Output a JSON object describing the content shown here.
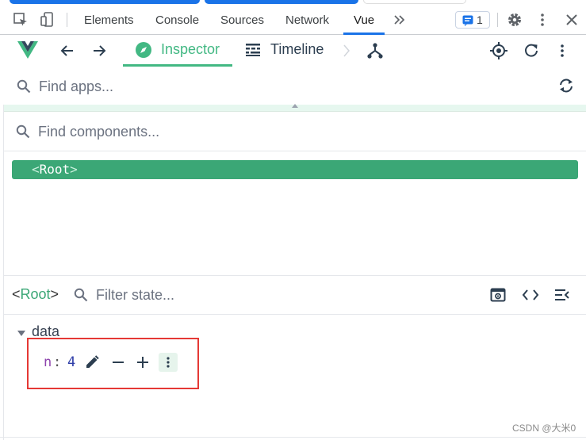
{
  "devtools": {
    "tabs": [
      "Elements",
      "Console",
      "Sources",
      "Network",
      "Vue"
    ],
    "active_tab": "Vue",
    "issues_count": "1",
    "accent": "#1a73e8"
  },
  "vue_toolbar": {
    "tabs": [
      {
        "label": "Inspector",
        "icon": "compass-icon"
      },
      {
        "label": "Timeline",
        "icon": "timeline-icon"
      }
    ],
    "active": "Inspector",
    "accent": "#42b883"
  },
  "apps_search": {
    "placeholder": "Find apps..."
  },
  "components_search": {
    "placeholder": "Find components..."
  },
  "component_tree": {
    "items": [
      {
        "open": "<",
        "name": "Root",
        "close": ">"
      }
    ],
    "selected_color": "#3ba776"
  },
  "state_panel": {
    "selected_open": "<",
    "selected_name": "Root",
    "selected_close": ">",
    "filter_placeholder": "Filter state...",
    "sections": [
      {
        "title": "data",
        "props": [
          {
            "key": "n",
            "colon": ":",
            "value": "4"
          }
        ]
      }
    ]
  },
  "watermark": "CSDN @大米0"
}
